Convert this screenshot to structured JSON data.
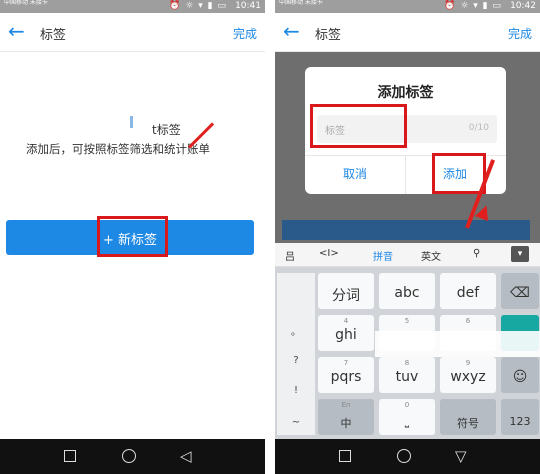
{
  "left": {
    "status": {
      "carrier": "中国移动\n未接卡",
      "time": "10:41"
    },
    "header": {
      "back_icon": "arrow-left-icon",
      "title": "标签",
      "done": "完成"
    },
    "empty": {
      "title": "t标签",
      "text": "添加后，可按照标签筛选和统计账单"
    },
    "add_button": {
      "label": "+ 新标签"
    }
  },
  "right": {
    "status": {
      "carrier": "中国移动\n未接卡",
      "time": "10:42"
    },
    "header": {
      "title": "标签",
      "done": "完成"
    },
    "dialog": {
      "title": "添加标签",
      "placeholder": "标签",
      "counter": "0/10",
      "cancel": "取消",
      "confirm": "添加"
    },
    "ime_toolbar": [
      "吕",
      "<I>",
      "拼音",
      "英文"
    ],
    "keyboard": {
      "side": [
        "。",
        "?",
        "!",
        "~"
      ],
      "rows": [
        [
          {
            "num": "",
            "label": "分词"
          },
          {
            "num": "",
            "label": "abc"
          },
          {
            "num": "",
            "label": "def"
          },
          {
            "num": "",
            "label": "⌫"
          }
        ],
        [
          {
            "num": "4",
            "label": "ghi"
          },
          {
            "num": "5",
            "label": ""
          },
          {
            "num": "6",
            "label": ""
          },
          {
            "num": "",
            "label": ""
          }
        ],
        [
          {
            "num": "7",
            "label": "pqrs"
          },
          {
            "num": "8",
            "label": "tuv"
          },
          {
            "num": "9",
            "label": "wxyz"
          },
          {
            "num": "",
            "label": "☺"
          }
        ],
        [
          {
            "num": "En",
            "label": "中"
          },
          {
            "num": "0",
            "label": ""
          },
          {
            "num": "",
            "label": "符号"
          },
          {
            "num": "",
            "label": "123"
          }
        ]
      ]
    }
  },
  "colors": {
    "accent": "#1e88e5",
    "highlight": "#d9181b"
  }
}
